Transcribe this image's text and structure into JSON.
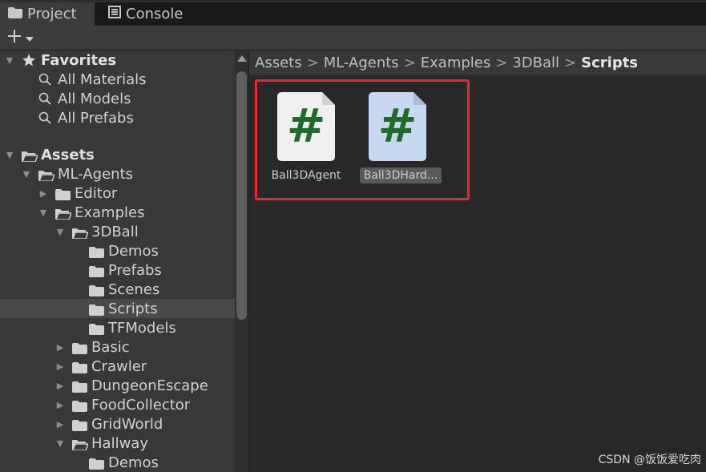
{
  "tabs": [
    {
      "label": "Project",
      "icon": "folder-icon",
      "active": true
    },
    {
      "label": "Console",
      "icon": "console-icon",
      "active": false
    }
  ],
  "toolbar": {
    "create_icon": "plus-icon",
    "dropdown_icon": "caret-down-icon"
  },
  "tree": {
    "favorites": {
      "label": "Favorites",
      "items": [
        "All Materials",
        "All Models",
        "All Prefabs"
      ]
    },
    "assets": {
      "label": "Assets",
      "ml_agents": "ML-Agents",
      "editor": "Editor",
      "examples": "Examples",
      "ball3d": "3DBall",
      "ball3d_children": [
        "Demos",
        "Prefabs",
        "Scenes",
        "Scripts",
        "TFModels"
      ],
      "selected": "Scripts",
      "example_folders": [
        "Basic",
        "Crawler",
        "DungeonEscape",
        "FoodCollector",
        "GridWorld"
      ],
      "hallway": "Hallway",
      "hallway_children": [
        "Demos"
      ]
    }
  },
  "breadcrumb": [
    "Assets",
    "ML-Agents",
    "Examples",
    "3DBall",
    "Scripts"
  ],
  "breadcrumb_separator": ">",
  "assets_grid": [
    {
      "label": "Ball3DAgent",
      "glyph": "#",
      "selected": false
    },
    {
      "label": "Ball3DHard...",
      "glyph": "#",
      "selected": true
    }
  ],
  "colors": {
    "highlight_border": "#e8282a",
    "script_hash": "#1f6b2a",
    "file_normal": "#f0f0f0",
    "file_selected": "#c8d8f0"
  },
  "watermark": "CSDN @饭饭爱吃肉"
}
